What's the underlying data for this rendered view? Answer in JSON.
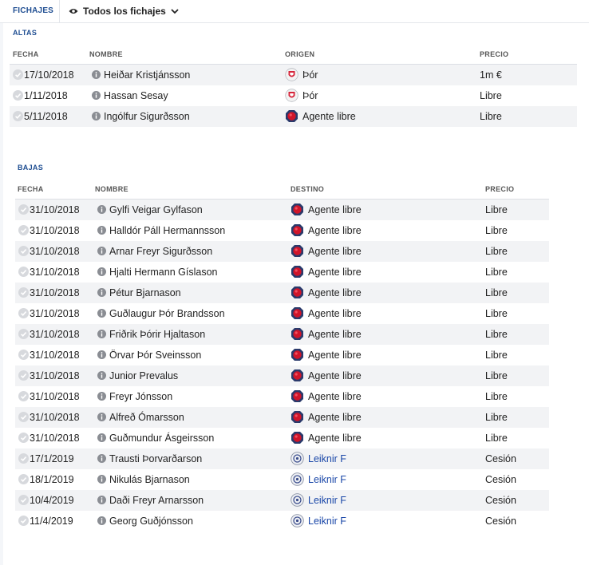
{
  "topbar": {
    "tab": "FICHAJES",
    "filter": {
      "icon": "eye-icon",
      "label": "Todos los fichajes",
      "chevron": "chevron-down-icon"
    }
  },
  "altas": {
    "title": "ALTAS",
    "columns": {
      "date": "FECHA",
      "name": "NOMBRE",
      "club": "ORIGEN",
      "price": "PRECIO"
    },
    "rows": [
      {
        "date": "17/10/2018",
        "name": "Heiðar Kristjánsson",
        "club": "Þór",
        "club_icon": "thor-crest-icon",
        "price": "1m €"
      },
      {
        "date": "1/11/2018",
        "name": "Hassan Sesay",
        "club": "Þór",
        "club_icon": "thor-crest-icon",
        "price": "Libre"
      },
      {
        "date": "5/11/2018",
        "name": "Ingólfur Sigurðsson",
        "club": "Agente libre",
        "club_icon": "free-agent-icon",
        "price": "Libre"
      }
    ]
  },
  "bajas": {
    "title": "BAJAS",
    "columns": {
      "date": "FECHA",
      "name": "NOMBRE",
      "club": "DESTINO",
      "price": "PRECIO"
    },
    "rows": [
      {
        "date": "31/10/2018",
        "name": "Gylfi Veigar Gylfason",
        "club": "Agente libre",
        "club_icon": "free-agent-icon",
        "price": "Libre"
      },
      {
        "date": "31/10/2018",
        "name": "Halldór Páll Hermannsson",
        "club": "Agente libre",
        "club_icon": "free-agent-icon",
        "price": "Libre"
      },
      {
        "date": "31/10/2018",
        "name": "Arnar Freyr Sigurðsson",
        "club": "Agente libre",
        "club_icon": "free-agent-icon",
        "price": "Libre"
      },
      {
        "date": "31/10/2018",
        "name": "Hjalti Hermann Gíslason",
        "club": "Agente libre",
        "club_icon": "free-agent-icon",
        "price": "Libre"
      },
      {
        "date": "31/10/2018",
        "name": "Pétur Bjarnason",
        "club": "Agente libre",
        "club_icon": "free-agent-icon",
        "price": "Libre"
      },
      {
        "date": "31/10/2018",
        "name": "Guðlaugur Þór Brandsson",
        "club": "Agente libre",
        "club_icon": "free-agent-icon",
        "price": "Libre"
      },
      {
        "date": "31/10/2018",
        "name": "Friðrik Þórir Hjaltason",
        "club": "Agente libre",
        "club_icon": "free-agent-icon",
        "price": "Libre"
      },
      {
        "date": "31/10/2018",
        "name": "Örvar Þór Sveinsson",
        "club": "Agente libre",
        "club_icon": "free-agent-icon",
        "price": "Libre"
      },
      {
        "date": "31/10/2018",
        "name": "Junior Prevalus",
        "club": "Agente libre",
        "club_icon": "free-agent-icon",
        "price": "Libre"
      },
      {
        "date": "31/10/2018",
        "name": "Freyr Jónsson",
        "club": "Agente libre",
        "club_icon": "free-agent-icon",
        "price": "Libre"
      },
      {
        "date": "31/10/2018",
        "name": "Alfreð Ómarsson",
        "club": "Agente libre",
        "club_icon": "free-agent-icon",
        "price": "Libre"
      },
      {
        "date": "31/10/2018",
        "name": "Guðmundur Ásgeirsson",
        "club": "Agente libre",
        "club_icon": "free-agent-icon",
        "price": "Libre"
      },
      {
        "date": "17/1/2019",
        "name": "Trausti Þorvarðarson",
        "club": "Leiknir F",
        "club_icon": "leiknir-crest-icon",
        "price": "Cesión"
      },
      {
        "date": "18/1/2019",
        "name": "Nikulás Bjarnason",
        "club": "Leiknir F",
        "club_icon": "leiknir-crest-icon",
        "price": "Cesión"
      },
      {
        "date": "10/4/2019",
        "name": "Daði Freyr Arnarsson",
        "club": "Leiknir F",
        "club_icon": "leiknir-crest-icon",
        "price": "Cesión"
      },
      {
        "date": "11/4/2019",
        "name": "Georg Guðjónsson",
        "club": "Leiknir F",
        "club_icon": "leiknir-crest-icon",
        "price": "Cesión"
      }
    ]
  },
  "colors": {
    "accent": "#1f4e92",
    "link": "#1a47a8",
    "row_alt": "#f2f3f5",
    "free_agent_red": "#d0152a"
  }
}
